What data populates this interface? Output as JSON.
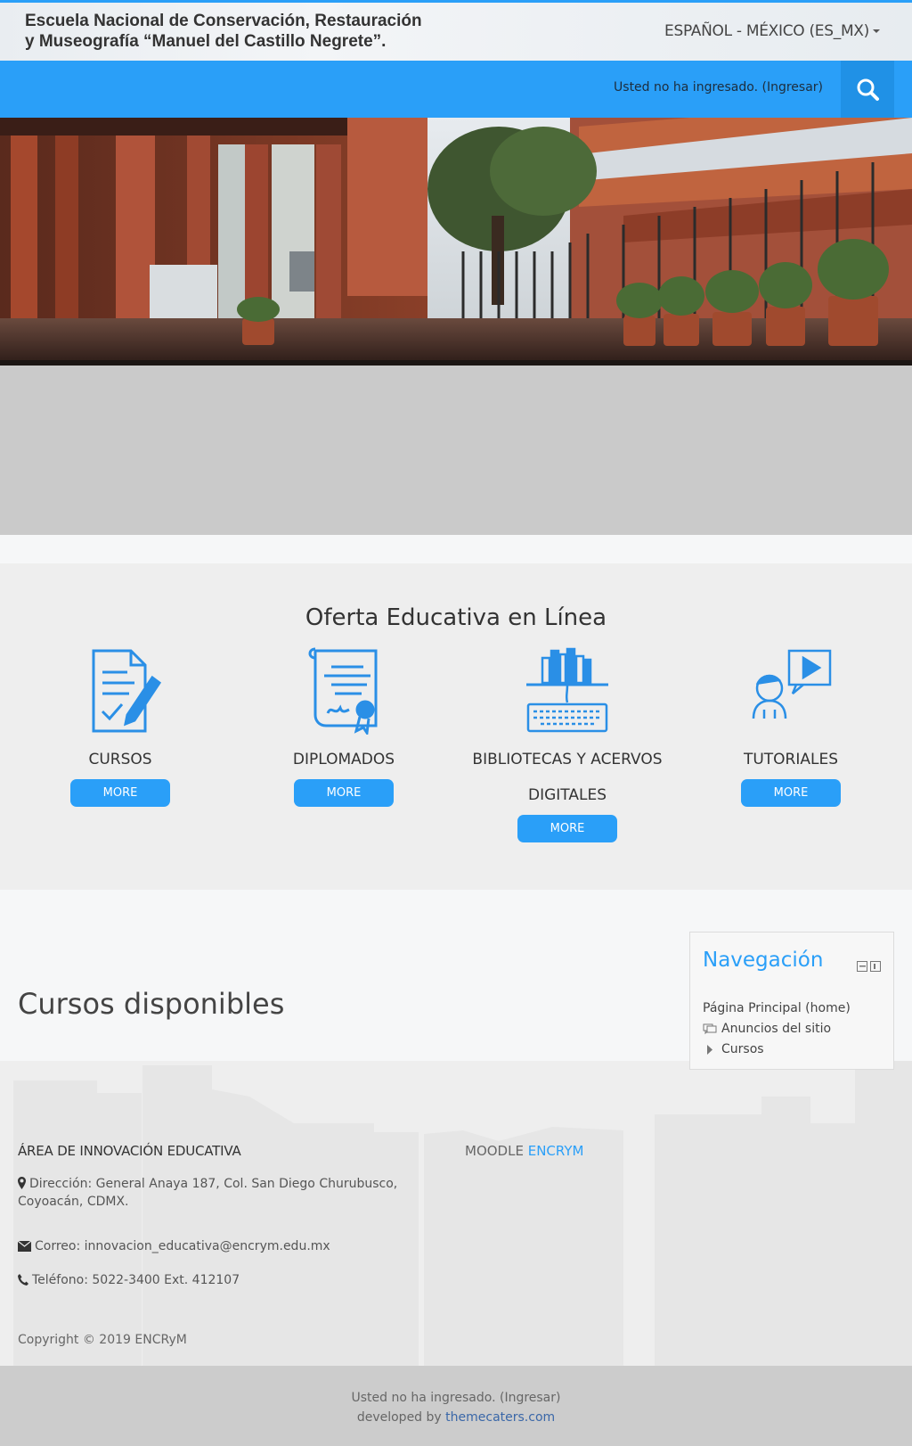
{
  "header": {
    "brand_line1": "Escuela Nacional de Conservación, Restauración",
    "brand_line2": "y Museografía “Manuel del Castillo Negrete”.",
    "language": "ESPAÑOL - MÉXICO (ES_MX)",
    "login_text": "Usted no ha ingresado. (Ingresar)",
    "search_icon": "search-icon"
  },
  "oferta": {
    "title": "Oferta Educativa en Línea",
    "items": [
      {
        "label": "CURSOS",
        "button": "MORE",
        "icon": "document-pencil-icon"
      },
      {
        "label": "DIPLOMADOS",
        "button": "MORE",
        "icon": "diploma-certificate-icon"
      },
      {
        "label": "BIBLIOTECAS Y ACERVOS DIGITALES",
        "button": "MORE",
        "icon": "library-keyboard-icon"
      },
      {
        "label": "TUTORIALES",
        "button": "MORE",
        "icon": "video-tutorial-icon"
      }
    ]
  },
  "main": {
    "title": "Cursos disponibles"
  },
  "navigation": {
    "title": "Navegación",
    "items": [
      "Página Principal (home)",
      "Anuncios del sitio",
      "Cursos"
    ]
  },
  "footer": {
    "heading": "ÁREA DE INNOVACIÓN EDUCATIVA",
    "address": "Dirección: General Anaya 187, Col. San Diego Churubusco, Coyoacán, CDMX.",
    "email": "Correo: innovacion_educativa@encrym.edu.mx",
    "phone": "Teléfono: 5022-3400 Ext. 412107",
    "copyright": "Copyright © 2019 ENCRyM",
    "moodle_prefix": "MOODLE",
    "moodle_accent": "ENCRYM"
  },
  "bottom": {
    "login_text": "Usted no ha ingresado. (Ingresar)",
    "developed_prefix": "developed by",
    "developed_link": "themecaters.com"
  },
  "colors": {
    "accent": "#2a9ff8",
    "dark_accent": "#2091e6",
    "grey_band": "#cacaca"
  }
}
